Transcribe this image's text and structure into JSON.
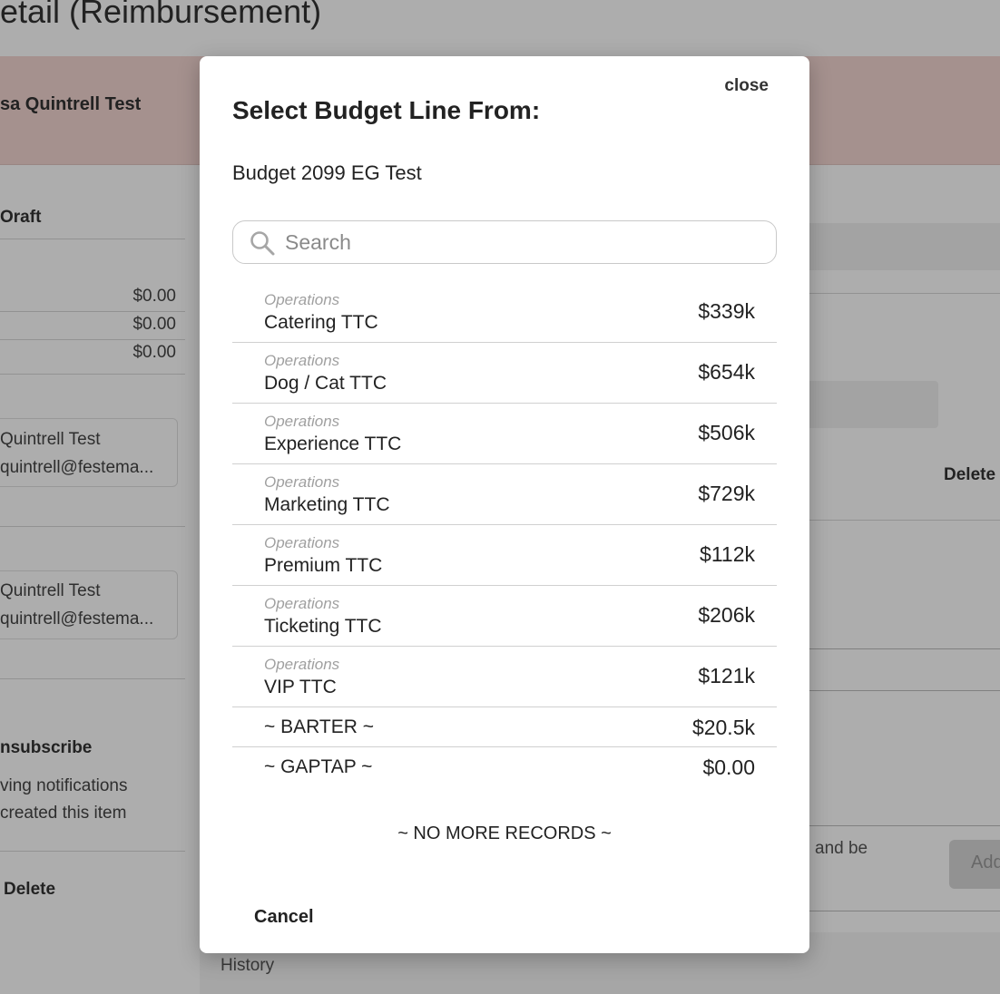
{
  "background": {
    "page_title": "etail (Reimbursement)",
    "banner_name": "sa Quintrell Test",
    "status": "Oraft",
    "amounts": [
      "$0.00",
      "$0.00",
      "$0.00"
    ],
    "cards": [
      {
        "name": "Quintrell Test",
        "email": "quintrell@festema..."
      },
      {
        "name": "Quintrell Test",
        "email": "quintrell@festema..."
      }
    ],
    "unsubscribe_label": "nsubscribe",
    "notes": [
      "ving notifications",
      "created this item"
    ],
    "delete_left": "Delete",
    "delete_right": "Delete",
    "and_be": "and be",
    "add_label": "Add",
    "history_label": "History"
  },
  "modal": {
    "close_label": "close",
    "title": "Select Budget Line From:",
    "subtitle": "Budget 2099 EG Test",
    "search": {
      "placeholder": "Search",
      "value": ""
    },
    "items": [
      {
        "category": "Operations",
        "name": "Catering TTC",
        "amount": "$339k"
      },
      {
        "category": "Operations",
        "name": "Dog / Cat TTC",
        "amount": "$654k"
      },
      {
        "category": "Operations",
        "name": "Experience TTC",
        "amount": "$506k"
      },
      {
        "category": "Operations",
        "name": "Marketing TTC",
        "amount": "$729k"
      },
      {
        "category": "Operations",
        "name": "Premium TTC",
        "amount": "$112k"
      },
      {
        "category": "Operations",
        "name": "Ticketing TTC",
        "amount": "$206k"
      },
      {
        "category": "Operations",
        "name": "VIP TTC",
        "amount": "$121k"
      }
    ],
    "simple_items": [
      {
        "name": "~ BARTER ~",
        "amount": "$20.5k"
      },
      {
        "name": "~ GAPTAP ~",
        "amount": "$0.00"
      }
    ],
    "no_more_label": "~ NO MORE RECORDS ~",
    "cancel_label": "Cancel"
  }
}
